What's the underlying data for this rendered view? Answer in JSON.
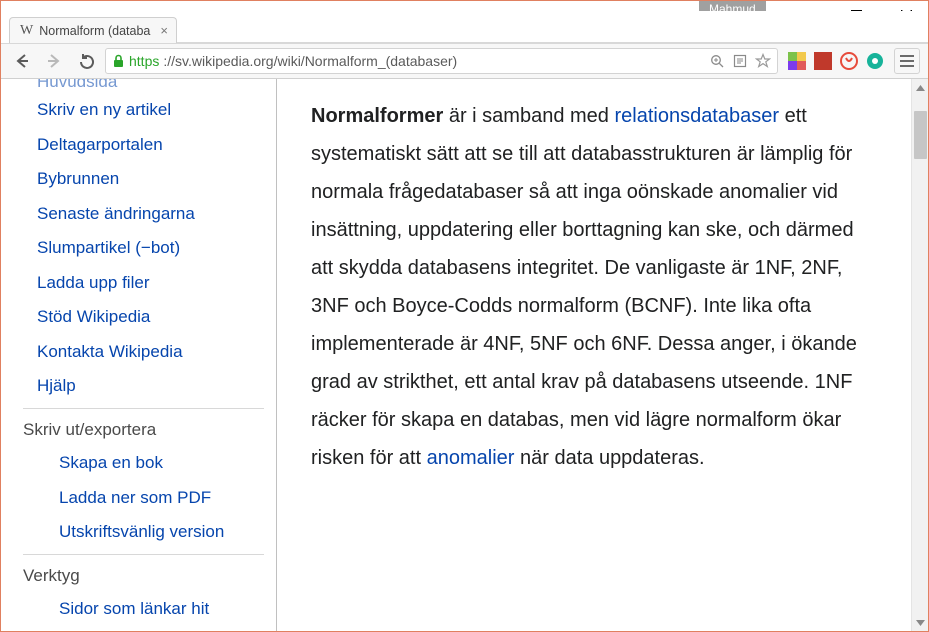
{
  "window": {
    "user_badge": "Mahmud"
  },
  "tab": {
    "title": "Normalform (databa",
    "favicon_glyph": "W"
  },
  "address": {
    "scheme": "https",
    "rest": "://sv.wikipedia.org/wiki/Normalform_(databaser)"
  },
  "sidebar": {
    "truncated_top": "Huvudsida",
    "main_links": [
      "Skriv en ny artikel",
      "Deltagarportalen",
      "Bybrunnen",
      "Senaste ändringarna",
      "Slumpartikel (−bot)",
      "Ladda upp filer",
      "Stöd Wikipedia",
      "Kontakta Wikipedia",
      "Hjälp"
    ],
    "section1_title": "Skriv ut/exportera",
    "section1_links": [
      "Skapa en bok",
      "Ladda ner som PDF",
      "Utskriftsvänlig version"
    ],
    "section2_title": "Verktyg",
    "section2_links": [
      "Sidor som länkar hit"
    ]
  },
  "article": {
    "bold_lead": "Normalformer",
    "t1": " är i samband med ",
    "link1": "relationsdatabaser",
    "t2": " ett systematiskt sätt att se till att databasstrukturen är lämplig för normala frågedatabaser så att inga oönskade anomalier vid insättning, uppdatering eller borttagning kan ske, och därmed att skydda databasens integritet. De vanligaste är 1NF, 2NF, 3NF och Boyce-Codds normalform (BCNF). Inte lika ofta implementerade är 4NF, 5NF och 6NF. Dessa anger, i ökande grad av strikthet, ett antal krav på databasens utseende. 1NF räcker för skapa en databas, men vid lägre normalform ökar risken för att ",
    "link2": "anomalier",
    "t3": " när data uppdateras."
  }
}
